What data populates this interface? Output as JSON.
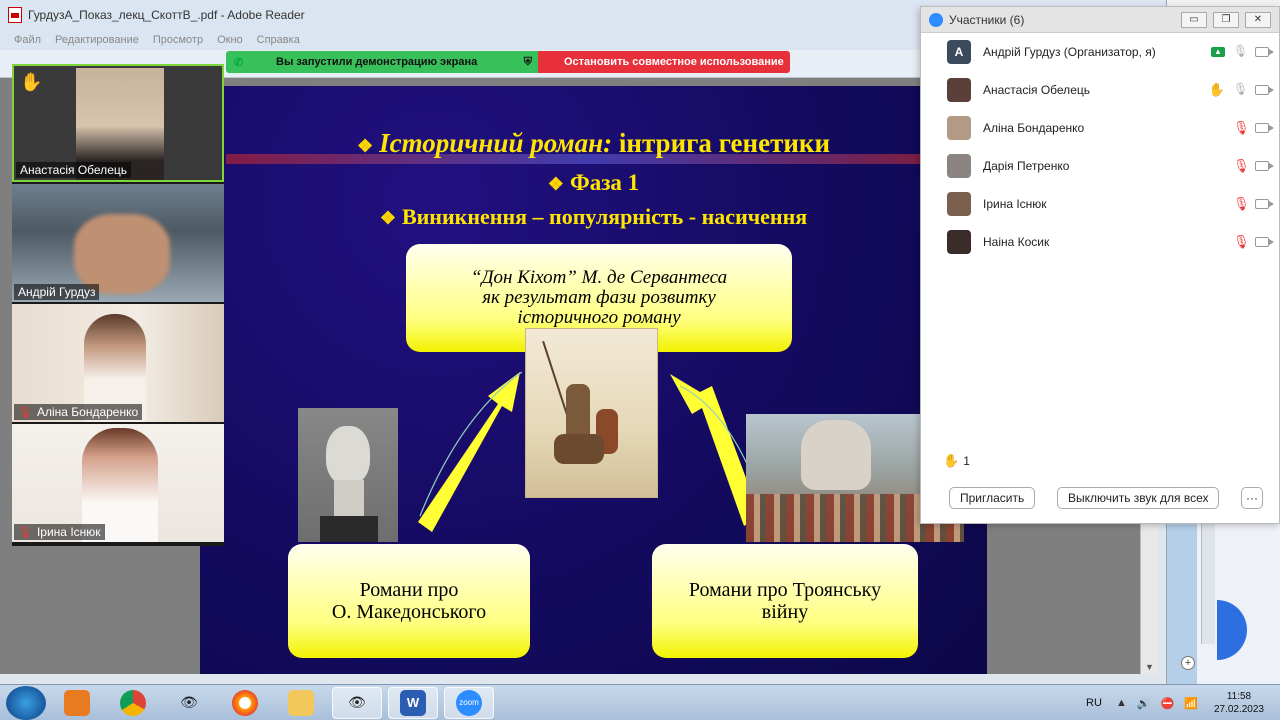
{
  "reader": {
    "title": "ГурдузА_Показ_лекц_СкоттВ_.pdf - Adobe Reader",
    "menu": [
      "Файл",
      "Редактирование",
      "Просмотр",
      "Окно",
      "Справка"
    ]
  },
  "share_banner": {
    "sharing_text": "Вы запустили демонстрацию экрана",
    "stop_text": "Остановить совместное использование"
  },
  "slide": {
    "title_italic": "Історичний роман:",
    "title_rest": " інтрига генетики",
    "phase": "Фаза 1",
    "stages": "Виникнення – популярність - насичення",
    "box_top": [
      "“Дон Кіхот” М. де Сервантеса",
      "як результат фази розвитку",
      "історичного роману"
    ],
    "box_left": [
      "Романи про",
      "О. Македонського"
    ],
    "box_right": [
      "Романи про Троянську",
      "війну"
    ]
  },
  "videos": [
    {
      "name": "Анастасія Обелець",
      "muted": false
    },
    {
      "name": "Андрій Гурдуз",
      "muted": false
    },
    {
      "name": "Аліна Бондаренко",
      "muted": true
    },
    {
      "name": "Ірина Існюк",
      "muted": true
    }
  ],
  "participants": {
    "title": "Участники (6)",
    "list": [
      {
        "name": "Андрій Гурдуз (Организатор, я)",
        "avatar": "A"
      },
      {
        "name": "Анастасія Обелець",
        "avatar": ""
      },
      {
        "name": "Аліна Бондаренко",
        "avatar": ""
      },
      {
        "name": "Дарія Петренко",
        "avatar": ""
      },
      {
        "name": "Ірина Існюк",
        "avatar": ""
      },
      {
        "name": "Наіна Косик",
        "avatar": ""
      }
    ],
    "raised_count": "1",
    "invite": "Пригласить",
    "mute_all": "Выключить звук для всех",
    "more": "···"
  },
  "taskbar": {
    "lang": "RU",
    "time": "11:58",
    "date": "27.02.2023",
    "zoom_label": "zoom"
  },
  "colors": {
    "slide_text": "#ffe600",
    "share_green": "#38c05a",
    "share_red": "#e8303a",
    "zoom_blue": "#2d8cff"
  }
}
